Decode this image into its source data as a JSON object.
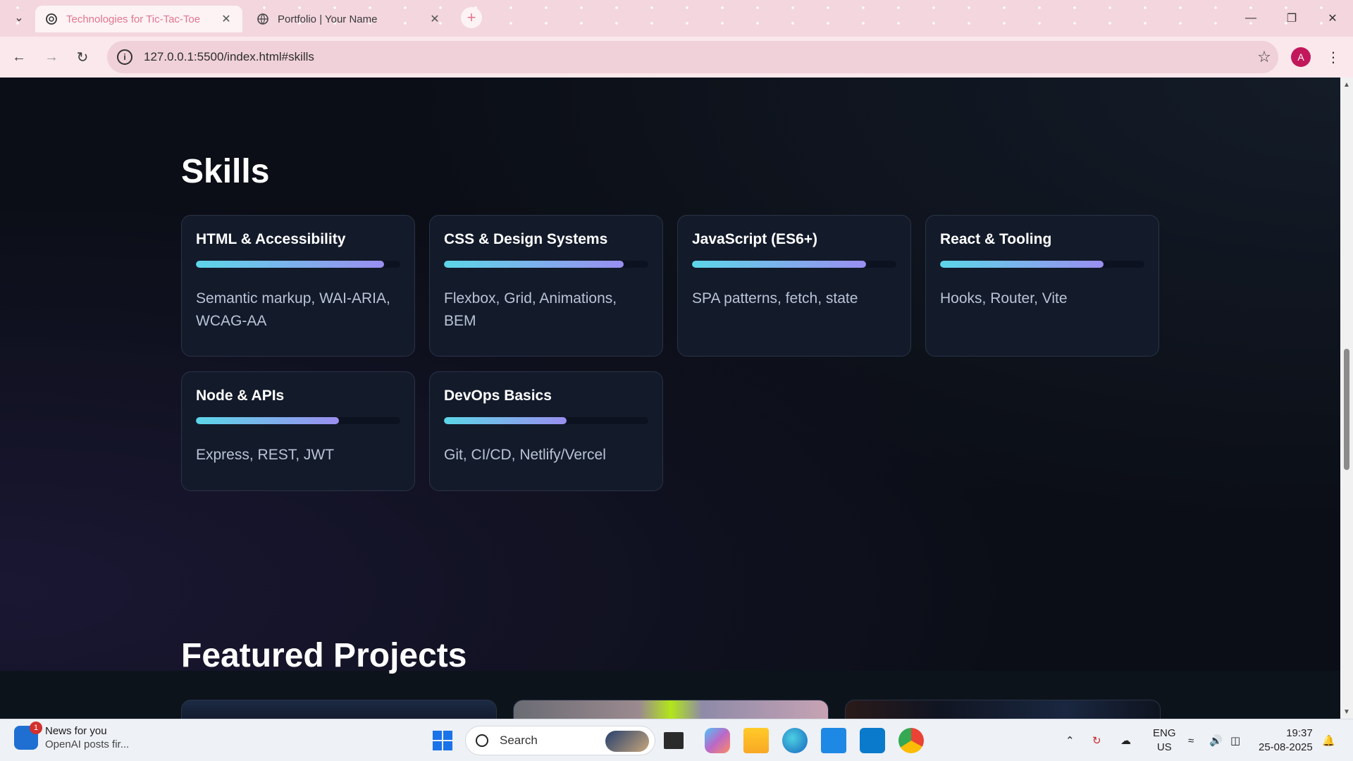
{
  "browser": {
    "tabs": [
      {
        "title": "Technologies for Tic-Tac-Toe",
        "active": true
      },
      {
        "title": "Portfolio | Your Name",
        "active": false
      }
    ],
    "url": "127.0.0.1:5500/index.html#skills",
    "profile_initial": "A"
  },
  "page": {
    "skills_heading": "Skills",
    "projects_heading": "Featured Projects",
    "skills": [
      {
        "title": "HTML & Accessibility",
        "level": 0.92,
        "desc": "Semantic markup, WAI-ARIA, WCAG-AA"
      },
      {
        "title": "CSS & Design Systems",
        "level": 0.88,
        "desc": "Flexbox, Grid, Animations, BEM"
      },
      {
        "title": "JavaScript (ES6+)",
        "level": 0.85,
        "desc": "SPA patterns, fetch, state"
      },
      {
        "title": "React & Tooling",
        "level": 0.8,
        "desc": "Hooks, Router, Vite"
      },
      {
        "title": "Node & APIs",
        "level": 0.7,
        "desc": "Express, REST, JWT"
      },
      {
        "title": "DevOps Basics",
        "level": 0.6,
        "desc": "Git, CI/CD, Netlify/Vercel"
      }
    ]
  },
  "taskbar": {
    "news_title": "News for you",
    "news_sub": "OpenAI posts fir...",
    "news_badge": "1",
    "search_label": "Search",
    "lang_line1": "ENG",
    "lang_line2": "US",
    "time": "19:37",
    "date": "25-08-2025"
  },
  "colors": {
    "accent_start": "#5cd6e8",
    "accent_end": "#9a8ef0",
    "card_bg": "#131a2a",
    "page_bg": "#0b0e16"
  }
}
